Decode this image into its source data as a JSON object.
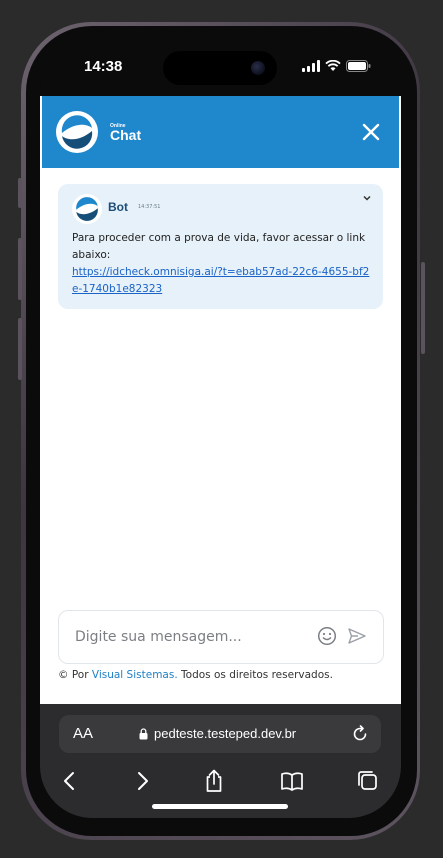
{
  "status_bar": {
    "time": "14:38"
  },
  "chat": {
    "logo_small_text": "Online",
    "logo_title": "Chat",
    "message": {
      "sender": "Bot",
      "timestamp": "14:37:51",
      "text": "Para proceder com a prova de vida, favor acessar o link abaixo:",
      "link": "https://idcheck.omnisiga.ai/?t=ebab57ad-22c6-4655-bf2e-1740b1e82323"
    },
    "input_placeholder": "Digite sua mensagem...",
    "footer": {
      "prefix": "© Por ",
      "link_text": "Visual Sistemas.",
      "suffix": " Todos os direitos reservados."
    }
  },
  "browser": {
    "aa_label": "AA",
    "url": "pedteste.testeped.dev.br"
  },
  "colors": {
    "header": "#1f87cc",
    "card": "#e6f1f9",
    "link": "#1a63c7"
  }
}
